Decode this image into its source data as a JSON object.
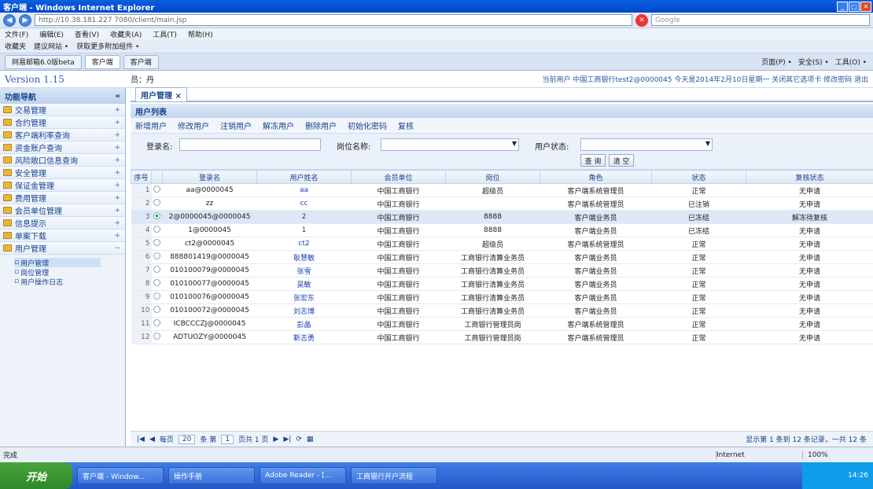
{
  "window": {
    "title": "客户端 - Windows Internet Explorer"
  },
  "addressbar": {
    "url": "http://10.38.181.227 7080/client/main.jsp"
  },
  "menubar": [
    "文件(F)",
    "编辑(E)",
    "查看(V)",
    "收藏夹(A)",
    "工具(T)",
    "帮助(H)"
  ],
  "favbar": [
    "收藏夹",
    "建议网站 •",
    "获取更多附加组件 •"
  ],
  "tabs": [
    "网易邮箱6.0版beta",
    "客户端",
    "客户端"
  ],
  "ie_tools": [
    "页面(P) •",
    "安全(S) •",
    "工具(O) •"
  ],
  "app": {
    "version": "Version 1.15",
    "welcome": "员：丹",
    "userinfo": "当前用户 中国工商银行test2@0000045 今天是2014年2月10日星期一   关闭其它选项卡 修改密码 退出"
  },
  "sidebar": {
    "title": "功能导航",
    "items": [
      "交易管理",
      "合约管理",
      "客户端利率查询",
      "资金账户查询",
      "风险敞口信息查询",
      "安全管理",
      "保证金管理",
      "费用管理",
      "会员单位管理",
      "信息提示",
      "单案下载",
      "用户管理"
    ],
    "subitems": [
      "用户管理",
      "岗位管理",
      "用户操作日志"
    ]
  },
  "main": {
    "tab": "用户管理 ×",
    "panel_title": "用户列表",
    "toolbar": [
      "新增用户",
      "修改用户",
      "注销用户",
      "解冻用户",
      "删除用户",
      "初始化密码",
      "复核"
    ],
    "form": {
      "login_label": "登录名:",
      "post_label": "岗位名称:",
      "status_label": "用户状态:",
      "query_btn": "查 询",
      "clear_btn": "清 空"
    },
    "columns": [
      "序号",
      "",
      "登录名",
      "用户姓名",
      "会员单位",
      "岗位",
      "角色",
      "状态",
      "复核状态"
    ],
    "rows": [
      [
        "1",
        "aa@0000045",
        "aa",
        "中国工商银行",
        "超级员",
        "客户端系统管理员",
        "正常",
        "无申请"
      ],
      [
        "2",
        "zz",
        "cc",
        "中国工商银行",
        "",
        "客户端系统管理员",
        "已注销",
        "无申请"
      ],
      [
        "3",
        "2@0000045@0000045",
        "2",
        "中国工商银行",
        "8888",
        "客户端业务员",
        "已冻结",
        "解冻待复核"
      ],
      [
        "4",
        "1@0000045",
        "1",
        "中国工商银行",
        "8888",
        "客户端业务员",
        "已冻结",
        "无申请"
      ],
      [
        "5",
        "ct2@0000045",
        "ct2",
        "中国工商银行",
        "超级员",
        "客户端系统管理员",
        "正常",
        "无申请"
      ],
      [
        "6",
        "888801419@0000045",
        "耿慧敏",
        "中国工商银行",
        "工商银行清算业务员",
        "客户端业务员",
        "正常",
        "无申请"
      ],
      [
        "7",
        "010100079@0000045",
        "张雪",
        "中国工商银行",
        "工商银行清算业务员",
        "客户端业务员",
        "正常",
        "无申请"
      ],
      [
        "8",
        "010100077@0000045",
        "吴敏",
        "中国工商银行",
        "工商银行清算业务员",
        "客户端业务员",
        "正常",
        "无申请"
      ],
      [
        "9",
        "010100076@0000045",
        "张宏东",
        "中国工商银行",
        "工商银行清算业务员",
        "客户端业务员",
        "正常",
        "无申请"
      ],
      [
        "10",
        "010100072@0000045",
        "刘志博",
        "中国工商银行",
        "工商银行清算业务员",
        "客户端业务员",
        "正常",
        "无申请"
      ],
      [
        "11",
        "ICBCCCZJ@0000045",
        "彭晶",
        "中国工商银行",
        "工商银行管理员岗",
        "客户端系统管理员",
        "正常",
        "无申请"
      ],
      [
        "12",
        "ADTUOZY@0000045",
        "靳志勇",
        "中国工商银行",
        "工商银行管理员岗",
        "客户端系统管理员",
        "正常",
        "无申请"
      ]
    ],
    "selected_row": 3,
    "pager": {
      "page_size_label": "每页",
      "page_size": "20",
      "unit": "条 第",
      "page": "1",
      "of": "页共 1 页",
      "summary": "显示第 1 条到 12 条记录，一共 12 条"
    }
  },
  "statusbar": {
    "text": "完成",
    "zone": "Internet",
    "zoom": "100%"
  },
  "taskbar": {
    "start": "开始",
    "tasks": [
      "客户端 - Window...",
      "操作手册",
      "Adobe Reader - [...",
      "工商银行开户流程"
    ],
    "clock": "14:26"
  }
}
